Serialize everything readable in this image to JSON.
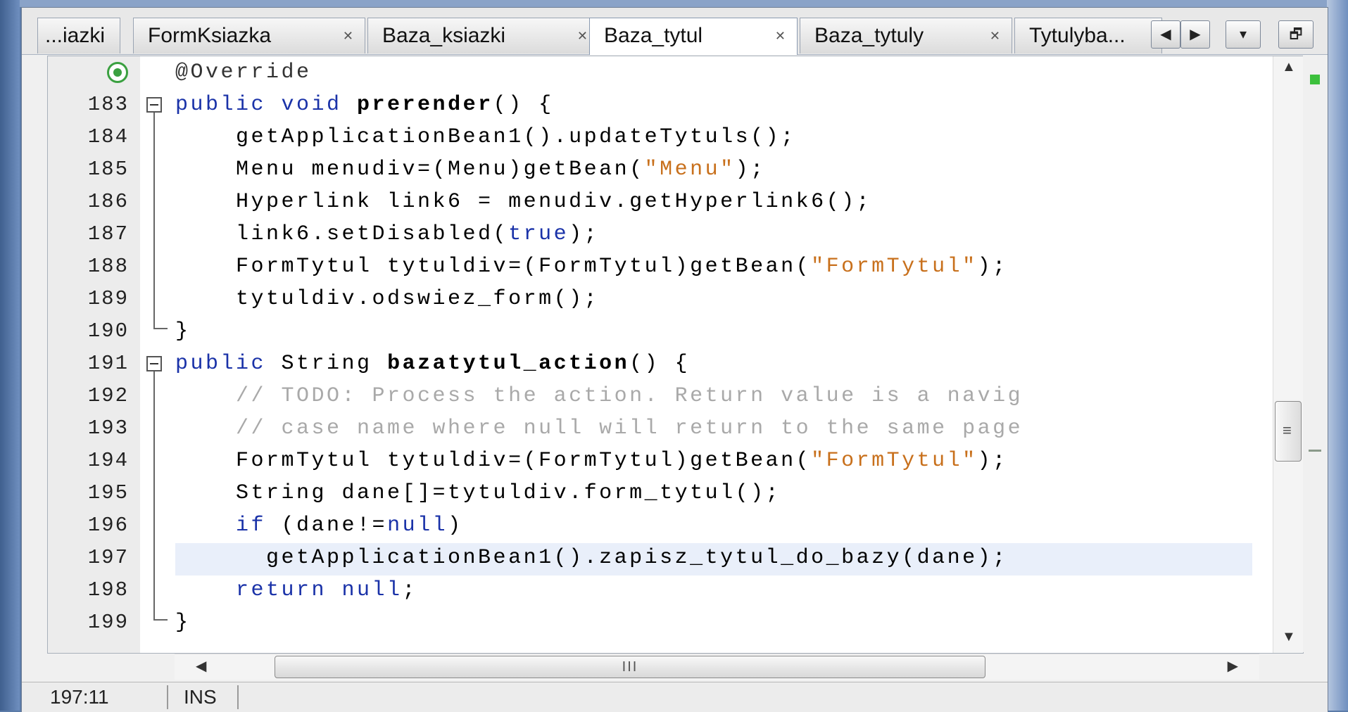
{
  "tabs": [
    {
      "label": "...iazki",
      "closable": false,
      "active": false
    },
    {
      "label": "FormKsiazka",
      "closable": true,
      "active": false
    },
    {
      "label": "Baza_ksiazki",
      "closable": true,
      "active": false
    },
    {
      "label": "Baza_tytul",
      "closable": true,
      "active": true
    },
    {
      "label": "Baza_tytuly",
      "closable": true,
      "active": false
    },
    {
      "label": "Tytulyba...",
      "closable": false,
      "active": false
    }
  ],
  "tab_close_glyph": "✕",
  "tab_nav": {
    "prev": "◀",
    "next": "▶",
    "list": "▾",
    "restore": "🗗"
  },
  "editor": {
    "lines": [
      {
        "num": "",
        "annotation": "@Override"
      },
      {
        "num": "183"
      },
      {
        "num": "184"
      },
      {
        "num": "185"
      },
      {
        "num": "186"
      },
      {
        "num": "187"
      },
      {
        "num": "188"
      },
      {
        "num": "189"
      },
      {
        "num": "190"
      },
      {
        "num": "191"
      },
      {
        "num": "192"
      },
      {
        "num": "193"
      },
      {
        "num": "194"
      },
      {
        "num": "195"
      },
      {
        "num": "196"
      },
      {
        "num": "197"
      },
      {
        "num": "198"
      },
      {
        "num": "199"
      }
    ],
    "code": {
      "l0": "@Override",
      "l1_kw": "public void ",
      "l1_name": "prerender",
      "l1_rest": "() {",
      "l2": "    getApplicationBean1().updateTytuls();",
      "l3_a": "    Menu menudiv=(Menu)getBean(",
      "l3_str": "\"Menu\"",
      "l3_b": ");",
      "l4": "    Hyperlink link6 = menudiv.getHyperlink6();",
      "l5_a": "    link6.setDisabled(",
      "l5_kw": "true",
      "l5_b": ");",
      "l6_a": "    FormTytul tytuldiv=(FormTytul)getBean(",
      "l6_str": "\"FormTytul\"",
      "l6_b": ");",
      "l7": "    tytuldiv.odswiez_form();",
      "l8": "}",
      "l9_kw": "public ",
      "l9_type": "String ",
      "l9_name": "bazatytul_action",
      "l9_rest": "() {",
      "l10": "    // TODO: Process the action. Return value is a navig",
      "l11": "    // case name where null will return to the same page",
      "l12_a": "    FormTytul tytuldiv=(FormTytul)getBean(",
      "l12_str": "\"FormTytul\"",
      "l12_b": ");",
      "l13": "    String dane[]=tytuldiv.form_tytul();",
      "l14_kw": "    if ",
      "l14_a": "(dane!=",
      "l14_null": "null",
      "l14_b": ")",
      "l15": "      getApplicationBean1().zapisz_tytul_do_bazy(dane);",
      "l16_kw": "    return null",
      "l16_b": ";",
      "l17": "}"
    }
  },
  "scroll": {
    "up": "▲",
    "down": "▼",
    "left": "◀",
    "right": "▶",
    "vgrip": "≡",
    "hgrip": "III"
  },
  "status": {
    "position": "197:11",
    "mode": "INS"
  },
  "colors": {
    "keyword": "#1a32a8",
    "string": "#c8701c",
    "comment": "#a9a9a9",
    "current_line": "#e9effa"
  }
}
